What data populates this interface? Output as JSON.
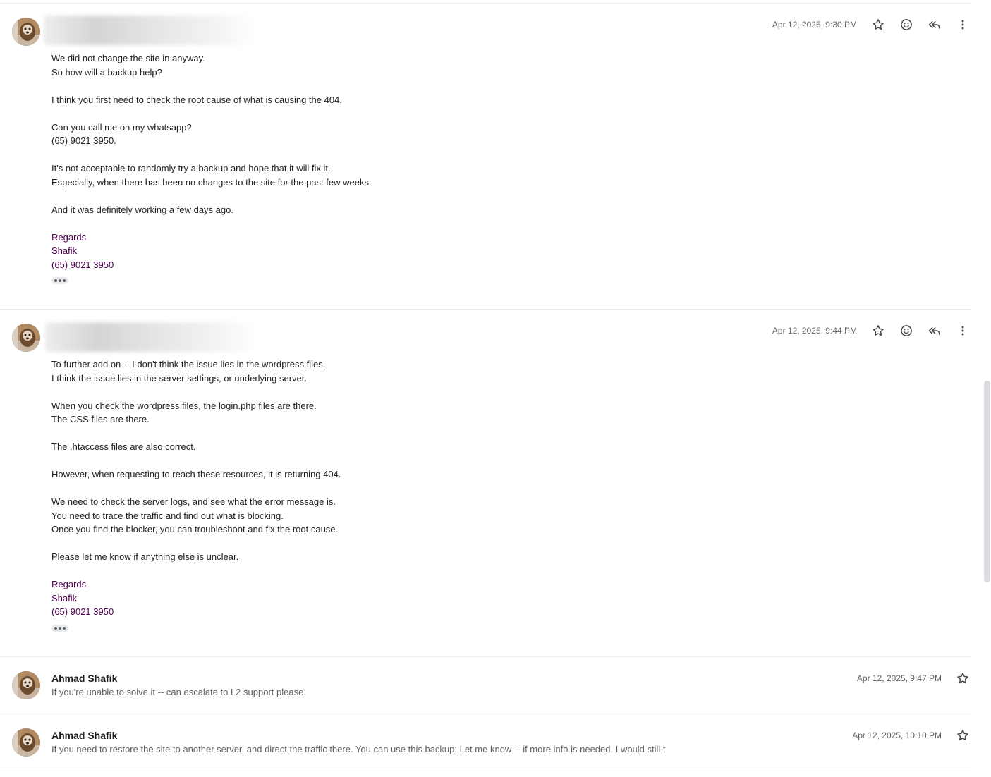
{
  "messages": [
    {
      "timestamp": "Apr 12, 2025, 9:30 PM",
      "body_lines": [
        "We did not change the site in anyway.",
        "So how will a backup help?",
        "",
        "I think you first need to check the root cause of what is causing the 404.",
        "",
        "Can you call me on my whatsapp?",
        "(65) 9021 3950.",
        "",
        "It's not acceptable to randomly try a backup and hope that it will fix it.",
        "Especially, when there has been no changes to the site for the past few weeks.",
        "",
        "And it was definitely working a few days ago."
      ],
      "signature": [
        "Regards",
        "Shafik",
        "(65) 9021 3950"
      ]
    },
    {
      "timestamp": "Apr 12, 2025, 9:44 PM",
      "body_lines": [
        "To further add on -- I don't think the issue lies in the wordpress files.",
        "I think the issue lies in the server settings, or underlying server.",
        "",
        "When you check the wordpress files, the login.php files are there.",
        "The CSS files are there.",
        "",
        "The .htaccess files are also correct.",
        "",
        "However, when requesting to reach these resources, it is returning 404.",
        "",
        "We need to check the server logs, and see what the error message is.",
        "You need to trace the traffic and find out what is blocking.",
        "Once you find the blocker, you can troubleshoot and fix the root cause.",
        "",
        "Please let me know if anything else is unclear."
      ],
      "signature": [
        "Regards",
        "Shafik",
        "(65) 9021 3950"
      ]
    }
  ],
  "collapsed": [
    {
      "sender": "Ahmad Shafik",
      "timestamp": "Apr 12, 2025, 9:47 PM",
      "snippet": "If you're unable to solve it -- can escalate to L2 support please."
    },
    {
      "sender": "Ahmad Shafik",
      "timestamp": "Apr 12, 2025, 10:10 PM",
      "snippet": "If you need to restore the site to another server, and direct the traffic there. You can use this backup: Let me know -- if more info is needed. I would still t"
    }
  ],
  "icons": {
    "star": "star-icon",
    "emoji": "emoji-reaction-icon",
    "reply_all": "reply-all-icon",
    "more": "more-vert-icon"
  }
}
